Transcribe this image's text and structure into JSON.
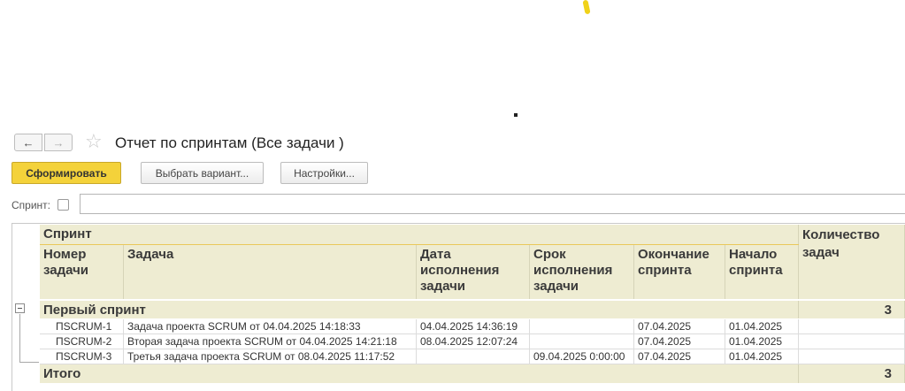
{
  "nav": {
    "back_icon": "←",
    "forward_icon": "→",
    "favorite_icon": "☆",
    "title": "Отчет по спринтам (Все задачи )"
  },
  "toolbar": {
    "generate_label": "Сформировать",
    "variant_label": "Выбрать вариант...",
    "settings_label": "Настройки..."
  },
  "filter": {
    "sprint_label": "Спринт:",
    "sprint_value": ""
  },
  "report": {
    "group_header": "Спринт",
    "count_header": "Количество задач",
    "columns": [
      "Номер задачи",
      "Задача",
      "Дата исполнения задачи",
      "Срок исполнения задачи",
      "Окончание спринта",
      "Начало спринта"
    ],
    "groups": [
      {
        "name": "Первый спринт",
        "count": "3",
        "rows": [
          {
            "num": "ПSCRUM-1",
            "task": "Задача проекта SCRUM от 04.04.2025 14:18:33",
            "done": "04.04.2025 14:36:19",
            "due": "",
            "end": "07.04.2025",
            "start": "01.04.2025"
          },
          {
            "num": "ПSCRUM-2",
            "task": "Вторая задача проекта SCRUM от 04.04.2025 14:21:18",
            "done": "08.04.2025 12:07:24",
            "due": "",
            "end": "07.04.2025",
            "start": "01.04.2025"
          },
          {
            "num": "ПSCRUM-3",
            "task": "Третья задача проекта SCRUM от 08.04.2025 11:17:52",
            "done": "",
            "due": "09.04.2025 0:00:00",
            "end": "07.04.2025",
            "start": "01.04.2025"
          }
        ]
      }
    ],
    "total_label": "Итого",
    "total_count": "3"
  },
  "colors": {
    "accent": "#f4d23a",
    "header_bg": "#eeecd2"
  }
}
